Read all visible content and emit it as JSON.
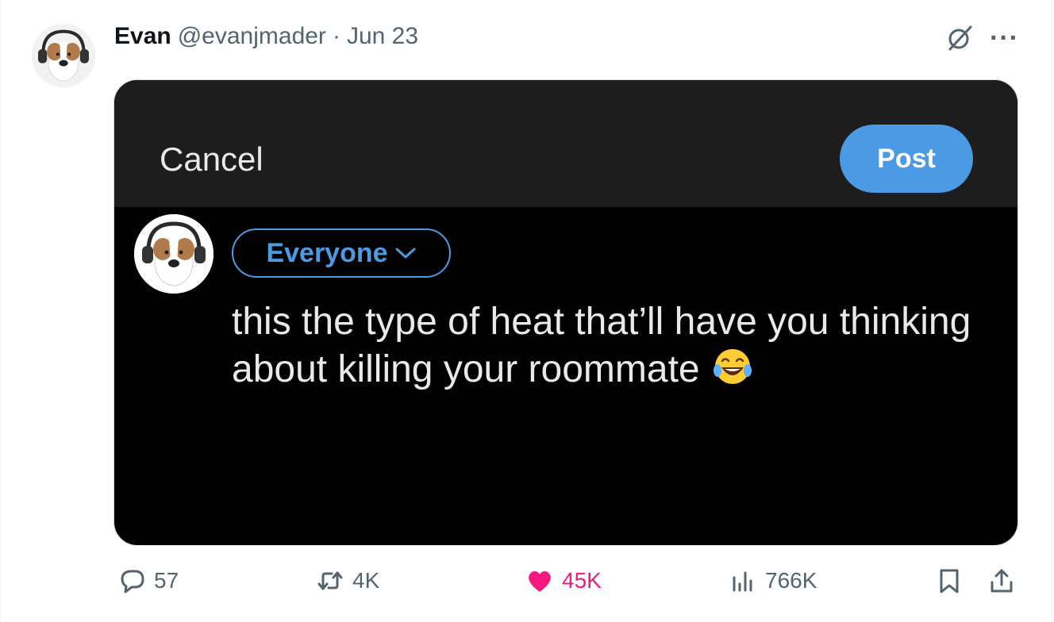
{
  "post": {
    "author_name": "Evan",
    "handle": "@evanjmader",
    "separator": "·",
    "date": "Jun 23"
  },
  "icons": {
    "grok": "grok-icon",
    "more": "more-icon",
    "reply": "speech-bubble-icon",
    "repost": "repost-arrows-icon",
    "like": "heart-icon",
    "views": "bar-chart-icon",
    "bookmark": "bookmark-icon",
    "share": "share-upload-icon"
  },
  "more_label": "···",
  "screenshot": {
    "cancel_label": "Cancel",
    "post_label": "Post",
    "audience_label": "Everyone",
    "text": "this the type of heat that’ll have you thinking about killing your roommate",
    "emoji": "face-with-tears-of-joy"
  },
  "engagement": {
    "replies": "57",
    "reposts": "4K",
    "likes": "45K",
    "views": "766K"
  },
  "colors": {
    "like_pink": "#f91880",
    "post_blue": "#4a9be4",
    "muted_gray": "#536471"
  }
}
